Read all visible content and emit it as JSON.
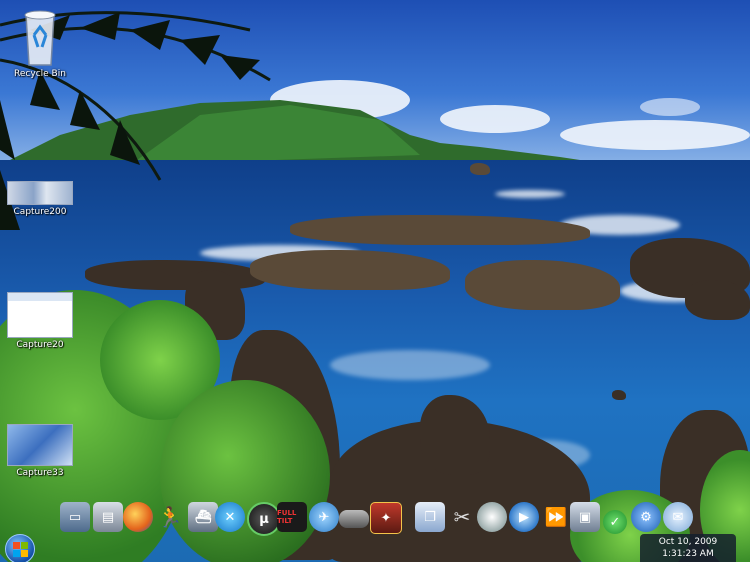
{
  "desktop_icons": [
    {
      "label": "Recycle Bin",
      "icon": "recycle-bin-icon"
    },
    {
      "label": "Capture200",
      "icon": "screenshot-thumbnail"
    },
    {
      "label": "Capture20",
      "icon": "screenshot-thumbnail"
    },
    {
      "label": "Capture33",
      "icon": "screenshot-thumbnail"
    }
  ],
  "dock_icons": [
    "computer-icon",
    "folder-icon",
    "firefox-icon",
    "runner-icon",
    "ship-icon",
    "blue-swirl-icon",
    "utorrent-icon",
    "fulltilt-poker-icon",
    "game-icon",
    "car-icon",
    "game-cover-icon",
    "windows-stack-icon",
    "tools-icon",
    "speaker-icon",
    "media-player-icon",
    "fast-forward-icon",
    "network-icon",
    "checkmark-icon",
    "gear-icon",
    "mail-icon"
  ],
  "dock_fulltilt_text": "FULL TILT",
  "clock": {
    "date": "Oct 10, 2009",
    "time": "1:31:23 AM"
  },
  "colors": {
    "sky": "#2a62c6",
    "ocean": "#1a5cae",
    "foliage": "#3c9a2a"
  }
}
